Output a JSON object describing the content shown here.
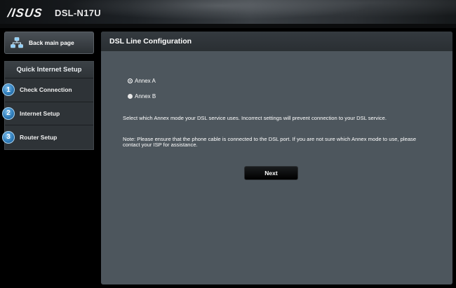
{
  "header": {
    "logo": "/ISUS",
    "model": "DSL-N17U"
  },
  "sidebar": {
    "back_label": "Back main page",
    "panel_title": "Quick Internet Setup",
    "steps": [
      {
        "num": "1",
        "label": "Check Connection"
      },
      {
        "num": "2",
        "label": "Internet Setup"
      },
      {
        "num": "3",
        "label": "Router Setup"
      }
    ]
  },
  "main": {
    "title": "DSL Line Configuration",
    "options": [
      {
        "label": "Annex A",
        "selected": true
      },
      {
        "label": "Annex B",
        "selected": false
      }
    ],
    "description": "Select which Annex mode your DSL service uses. Incorrect settings will prevent connection to your DSL service.",
    "note": "Note: Please ensure that the phone cable is connected to the DSL port. If you are not sure which Annex mode to use, please contact your ISP for assistance.",
    "next_label": "Next"
  }
}
